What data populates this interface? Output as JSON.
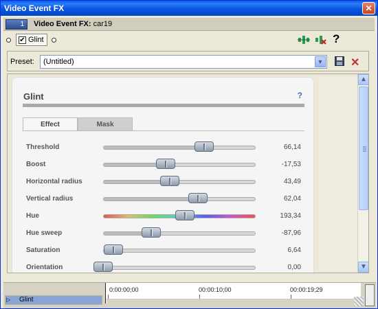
{
  "window": {
    "title": "Video Event FX",
    "close_icon": "close-icon"
  },
  "chain": {
    "track_number": "1",
    "title_prefix": "Video Event FX:",
    "event_name": "car19"
  },
  "fx_chain": {
    "items": [
      {
        "label": "Glint",
        "enabled": true
      }
    ],
    "tool_icons": [
      "plugin-chain-icon",
      "remove-plugin-icon",
      "help-icon"
    ]
  },
  "preset": {
    "label": "Preset:",
    "value": "(Untitled)",
    "dropdown_icon": "chevron-down-icon",
    "save_icon": "save-icon",
    "delete_icon": "delete-icon"
  },
  "plugin": {
    "title": "Glint",
    "help_label": "?",
    "tabs": [
      {
        "label": "Effect",
        "active": true
      },
      {
        "label": "Mask",
        "active": false
      }
    ],
    "params": [
      {
        "label": "Threshold",
        "value": "66,14",
        "fraction": 0.661
      },
      {
        "label": "Boost",
        "value": "-17,53",
        "fraction": 0.412
      },
      {
        "label": "Horizontal radius",
        "value": "43,49",
        "fraction": 0.435
      },
      {
        "label": "Vertical radius",
        "value": "62,04",
        "fraction": 0.62
      },
      {
        "label": "Hue",
        "value": "193,34",
        "fraction": 0.537,
        "hue": true
      },
      {
        "label": "Hue sweep",
        "value": "-87,96",
        "fraction": 0.315
      },
      {
        "label": "Saturation",
        "value": "6,64",
        "fraction": 0.066
      },
      {
        "label": "Orientation",
        "value": "0,00",
        "fraction": 0.0
      }
    ]
  },
  "timeline": {
    "track_label": "Glint",
    "ticks": [
      "0:00:00;00",
      "00:00:10;00",
      "00:00:19;29"
    ]
  }
}
